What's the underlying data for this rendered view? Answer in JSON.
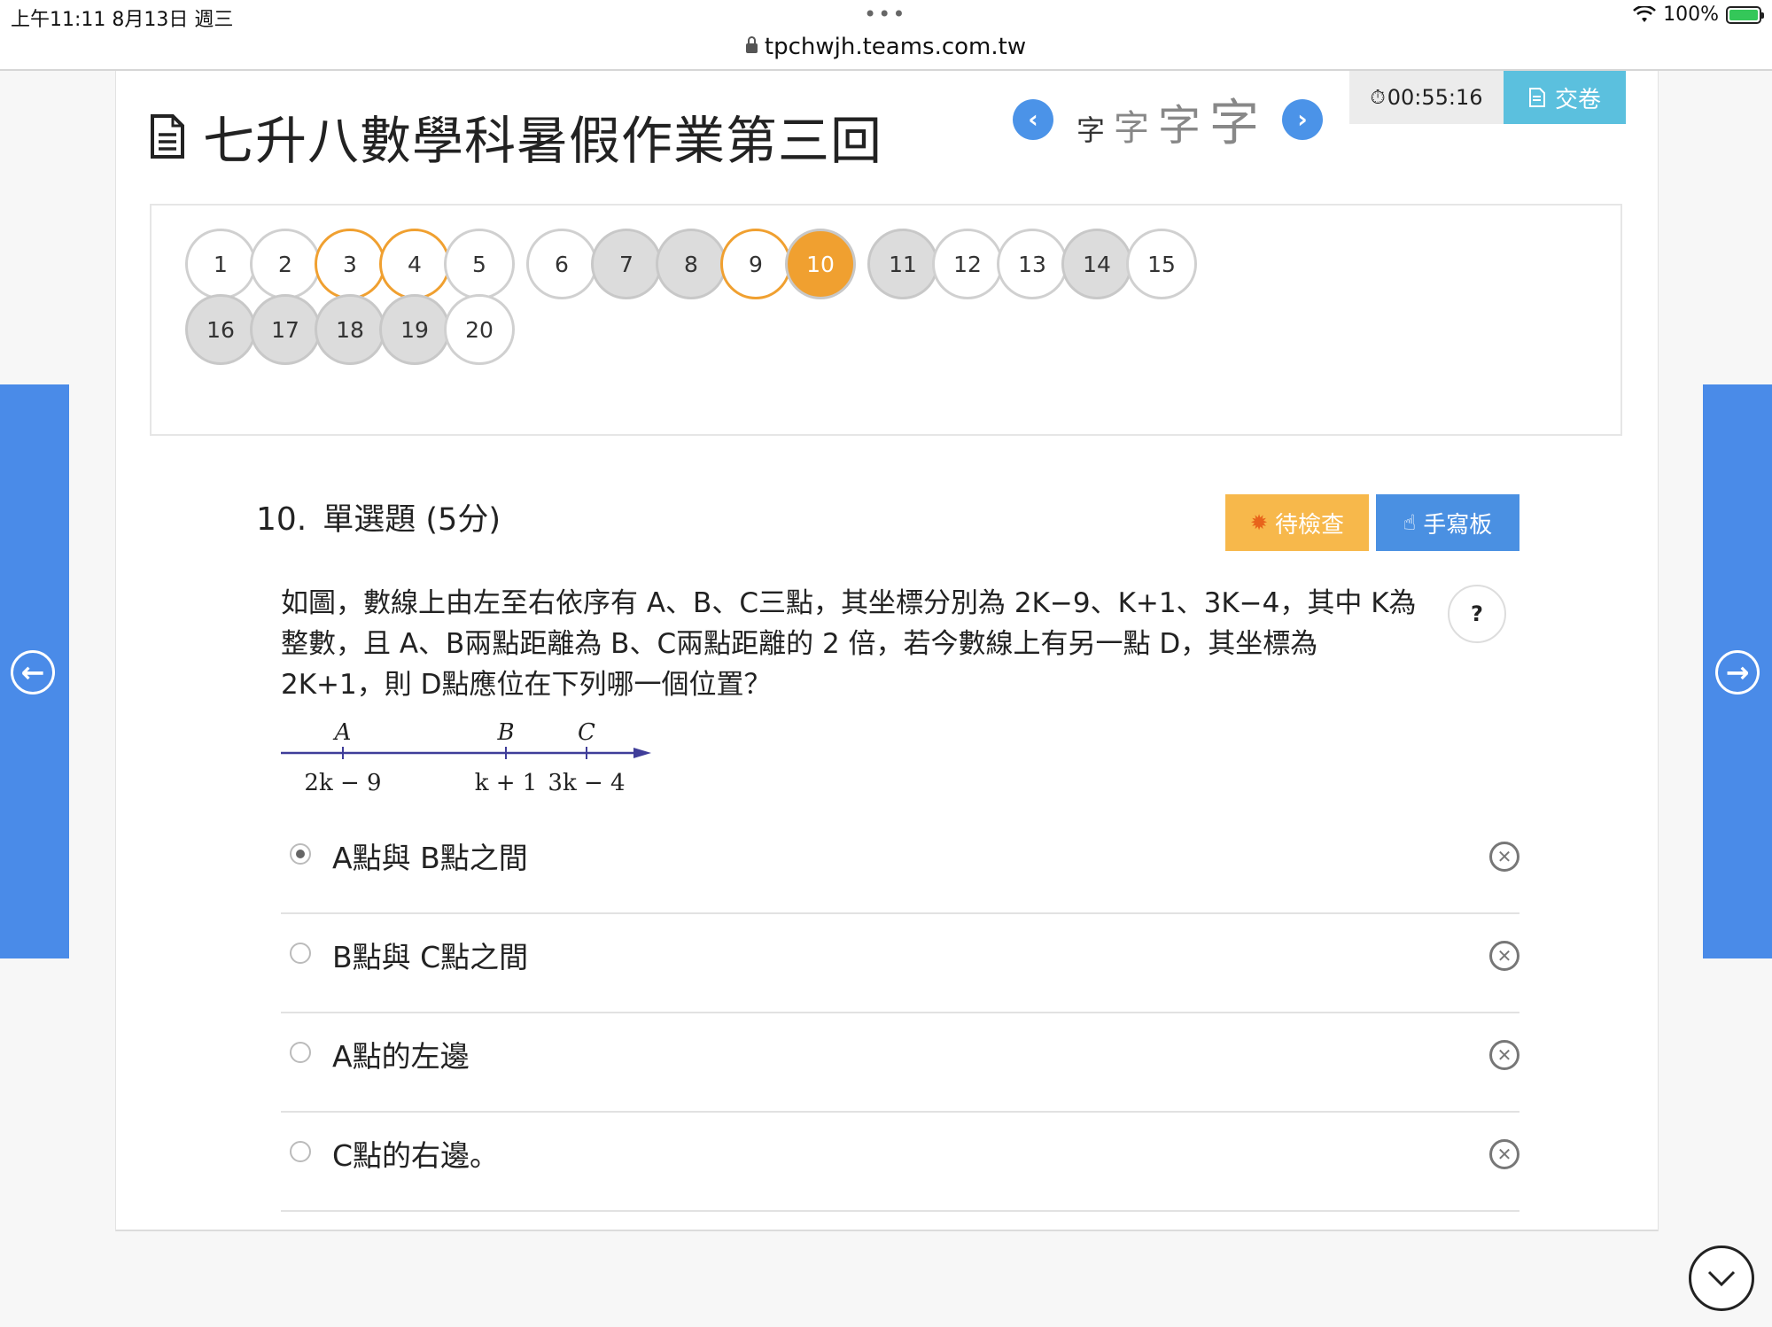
{
  "status_bar": {
    "time_date": "上午11:11   8月13日 週三",
    "dots": "•••",
    "url": "tpchwjh.teams.com.tw",
    "battery": "100%"
  },
  "header": {
    "title": "七升八數學科暑假作業第三回",
    "font_size_chars": [
      "字",
      "字",
      "字",
      "字"
    ],
    "timer": "00:55:16",
    "submit_label": "交卷"
  },
  "question_nav": [
    {
      "n": "1",
      "state": "unanswered"
    },
    {
      "n": "2",
      "state": "unanswered"
    },
    {
      "n": "3",
      "state": "flagged"
    },
    {
      "n": "4",
      "state": "flagged"
    },
    {
      "n": "5",
      "state": "unanswered"
    },
    {
      "n": "6",
      "state": "unanswered"
    },
    {
      "n": "7",
      "state": "answered"
    },
    {
      "n": "8",
      "state": "answered"
    },
    {
      "n": "9",
      "state": "flagged"
    },
    {
      "n": "10",
      "state": "current"
    },
    {
      "n": "11",
      "state": "answered"
    },
    {
      "n": "12",
      "state": "unanswered"
    },
    {
      "n": "13",
      "state": "unanswered"
    },
    {
      "n": "14",
      "state": "answered"
    },
    {
      "n": "15",
      "state": "unanswered"
    },
    {
      "n": "16",
      "state": "answered"
    },
    {
      "n": "17",
      "state": "answered"
    },
    {
      "n": "18",
      "state": "answered"
    },
    {
      "n": "19",
      "state": "answered"
    },
    {
      "n": "20",
      "state": "unanswered"
    }
  ],
  "question": {
    "number": "10.",
    "type_label": "單選題 (5分)",
    "review_label": "待檢查",
    "handwriting_label": "手寫板",
    "help_label": "?",
    "text": "如圖，數線上由左至右依序有 A、B、C三點，其坐標分別為 2K−9、K+1、3K−4，其中 K為整數，且 A、B兩點距離為 B、C兩點距離的 2 倍，若今數線上有另一點 D，其坐標為 2K+1，則 D點應位在下列哪一個位置？",
    "figure": {
      "points": [
        "A",
        "B",
        "C"
      ],
      "coords": [
        "2k − 9",
        "k + 1",
        "3k − 4"
      ]
    },
    "options": [
      {
        "label": "A點與 B點之間",
        "selected": true
      },
      {
        "label": "B點與 C點之間",
        "selected": false
      },
      {
        "label": "A點的左邊",
        "selected": false
      },
      {
        "label": "C點的右邊。",
        "selected": false
      }
    ]
  },
  "colors": {
    "accent_blue": "#4a8be8",
    "current_orange": "#f0a030",
    "review_orange": "#f7b84b",
    "submit_teal": "#5bc0de"
  },
  "icons": [
    "document-icon",
    "chevron-left-icon",
    "chevron-right-icon",
    "stopwatch-icon",
    "submit-icon",
    "bug-icon",
    "pointer-hand-icon",
    "help-icon",
    "close-circle-icon",
    "arrow-left-icon",
    "arrow-right-icon",
    "chevron-down-icon"
  ]
}
